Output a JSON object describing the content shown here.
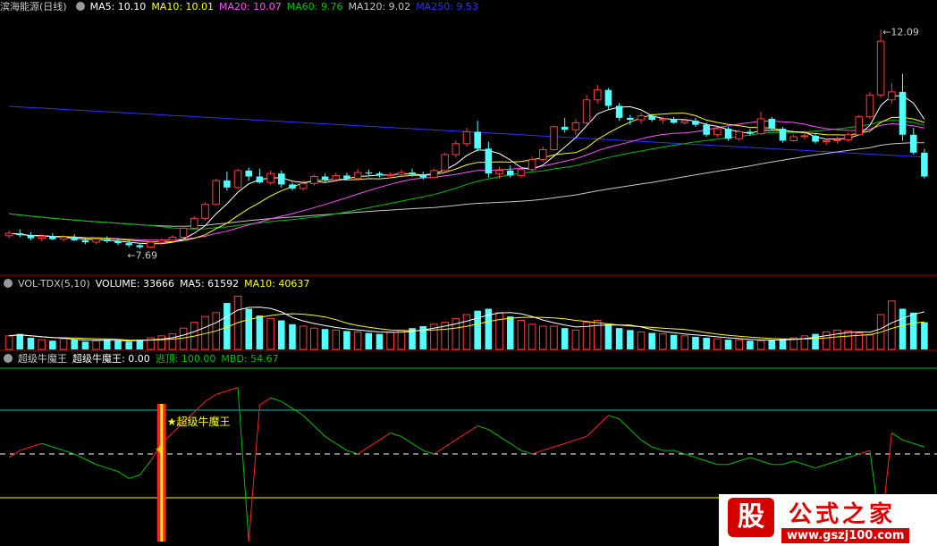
{
  "colors": {
    "up": "#ff3c3c",
    "down": "#54ffff",
    "ma5": "#ffffff",
    "ma10": "#ffff00",
    "ma20": "#ff50ff",
    "ma60": "#00c000",
    "ma120": "#c8c8c8",
    "ma250": "#3030ff",
    "label": "#c8c8c8",
    "panel_border": "#b00000",
    "osc_green": "#00c000",
    "osc_red": "#ff2020",
    "signal_bar": "#ff2020",
    "signal_core": "#ffff00",
    "hline_top": "#00c0c0",
    "hline_bottom": "#ffff00",
    "dash": "#ffffff"
  },
  "price_panel": {
    "stock_name": "滨海能源(日线)",
    "ma_labels": [
      {
        "text": "MA5: 10.10",
        "color": "#ffffff"
      },
      {
        "text": "MA10: 10.01",
        "color": "#ffff00"
      },
      {
        "text": "MA20: 10.07",
        "color": "#ff50ff"
      },
      {
        "text": "MA60: 9.76",
        "color": "#00c000"
      },
      {
        "text": "MA120: 9.02",
        "color": "#c8c8c8"
      },
      {
        "text": "MA250: 9.53",
        "color": "#3030ff"
      }
    ],
    "high_marker": "12.09",
    "low_marker": "7.69"
  },
  "volume_panel": {
    "title": "VOL-TDX(5,10)",
    "labels": [
      {
        "text": "VOLUME: 33666",
        "color": "#ffffff"
      },
      {
        "text": "MA5: 61592",
        "color": "#ffffff"
      },
      {
        "text": "MA10: 40637",
        "color": "#ffff00"
      }
    ]
  },
  "indicator_panel": {
    "title": "超级牛魔王",
    "labels": [
      {
        "text": "超级牛魔王: 0.00",
        "color": "#ffffff"
      },
      {
        "text": "逃顶: 100.00",
        "color": "#00c000"
      },
      {
        "text": "MBD: 54.67",
        "color": "#00c000"
      }
    ],
    "signal_label": "★超级牛魔王"
  },
  "logo": {
    "mark": "股",
    "name": "公式之家",
    "url": "www.gszj100.com"
  },
  "chart_data": [
    {
      "type": "candlestick",
      "ylim": [
        7.3,
        12.4
      ],
      "candles": [
        [
          7.95,
          8.05,
          7.9,
          8.0
        ],
        [
          8.0,
          8.08,
          7.92,
          7.96
        ],
        [
          7.96,
          8.02,
          7.86,
          7.9
        ],
        [
          7.9,
          7.98,
          7.84,
          7.94
        ],
        [
          7.94,
          8.0,
          7.86,
          7.88
        ],
        [
          7.88,
          7.96,
          7.84,
          7.92
        ],
        [
          7.92,
          7.98,
          7.84,
          7.86
        ],
        [
          7.86,
          7.92,
          7.78,
          7.82
        ],
        [
          7.82,
          7.9,
          7.78,
          7.88
        ],
        [
          7.88,
          7.94,
          7.8,
          7.84
        ],
        [
          7.84,
          7.9,
          7.76,
          7.8
        ],
        [
          7.8,
          7.86,
          7.72,
          7.76
        ],
        [
          7.76,
          7.8,
          7.69,
          7.72
        ],
        [
          7.72,
          7.84,
          7.7,
          7.82
        ],
        [
          7.82,
          7.9,
          7.76,
          7.86
        ],
        [
          7.86,
          7.96,
          7.8,
          7.92
        ],
        [
          7.92,
          8.12,
          7.9,
          8.1
        ],
        [
          8.1,
          8.34,
          8.08,
          8.3
        ],
        [
          8.3,
          8.62,
          8.26,
          8.58
        ],
        [
          8.58,
          9.1,
          8.56,
          9.06
        ],
        [
          9.06,
          9.24,
          8.86,
          8.92
        ],
        [
          8.92,
          9.3,
          8.88,
          9.26
        ],
        [
          9.26,
          9.32,
          9.06,
          9.14
        ],
        [
          9.14,
          9.3,
          9.0,
          9.02
        ],
        [
          9.02,
          9.26,
          8.98,
          9.2
        ],
        [
          9.2,
          9.26,
          8.92,
          8.98
        ],
        [
          8.98,
          9.02,
          8.86,
          8.9
        ],
        [
          8.9,
          9.06,
          8.86,
          9.0
        ],
        [
          9.0,
          9.18,
          8.96,
          9.14
        ],
        [
          9.14,
          9.2,
          9.02,
          9.08
        ],
        [
          9.08,
          9.22,
          9.04,
          9.16
        ],
        [
          9.16,
          9.22,
          9.06,
          9.1
        ],
        [
          9.1,
          9.3,
          9.06,
          9.22
        ],
        [
          9.22,
          9.28,
          9.14,
          9.2
        ],
        [
          9.2,
          9.24,
          9.12,
          9.16
        ],
        [
          9.16,
          9.22,
          9.1,
          9.18
        ],
        [
          9.18,
          9.28,
          9.12,
          9.22
        ],
        [
          9.22,
          9.3,
          9.14,
          9.18
        ],
        [
          9.18,
          9.24,
          9.08,
          9.12
        ],
        [
          9.12,
          9.3,
          9.1,
          9.26
        ],
        [
          9.26,
          9.62,
          9.24,
          9.58
        ],
        [
          9.58,
          9.86,
          9.52,
          9.8
        ],
        [
          9.8,
          10.12,
          9.74,
          10.04
        ],
        [
          10.04,
          10.26,
          9.64,
          9.7
        ],
        [
          9.7,
          9.84,
          9.12,
          9.2
        ],
        [
          9.2,
          9.34,
          9.1,
          9.26
        ],
        [
          9.26,
          9.36,
          9.12,
          9.16
        ],
        [
          9.16,
          9.34,
          9.12,
          9.28
        ],
        [
          9.28,
          9.54,
          9.24,
          9.48
        ],
        [
          9.48,
          9.74,
          9.44,
          9.68
        ],
        [
          9.68,
          10.16,
          9.66,
          10.14
        ],
        [
          10.14,
          10.32,
          10.02,
          10.08
        ],
        [
          10.08,
          10.3,
          9.98,
          10.22
        ],
        [
          10.22,
          10.78,
          10.2,
          10.68
        ],
        [
          10.68,
          10.98,
          10.6,
          10.88
        ],
        [
          10.88,
          10.92,
          10.5,
          10.56
        ],
        [
          10.56,
          10.62,
          10.26,
          10.32
        ],
        [
          10.32,
          10.38,
          10.18,
          10.28
        ],
        [
          10.28,
          10.42,
          10.2,
          10.36
        ],
        [
          10.36,
          10.4,
          10.24,
          10.28
        ],
        [
          10.28,
          10.34,
          10.2,
          10.3
        ],
        [
          10.3,
          10.34,
          10.2,
          10.22
        ],
        [
          10.22,
          10.3,
          10.18,
          10.26
        ],
        [
          10.26,
          10.32,
          10.14,
          10.18
        ],
        [
          10.18,
          10.22,
          9.94,
          9.98
        ],
        [
          9.98,
          10.14,
          9.94,
          10.1
        ],
        [
          10.1,
          10.14,
          9.86,
          9.9
        ],
        [
          9.9,
          10.08,
          9.86,
          10.04
        ],
        [
          10.04,
          10.1,
          9.96,
          10.0
        ],
        [
          10.0,
          10.44,
          9.98,
          10.3
        ],
        [
          10.3,
          10.34,
          10.06,
          10.1
        ],
        [
          10.1,
          10.14,
          9.82,
          9.86
        ],
        [
          9.86,
          9.98,
          9.84,
          9.94
        ],
        [
          9.94,
          10.06,
          9.88,
          9.96
        ],
        [
          9.96,
          10.0,
          9.8,
          9.84
        ],
        [
          9.84,
          9.9,
          9.78,
          9.86
        ],
        [
          9.86,
          9.94,
          9.8,
          9.88
        ],
        [
          9.88,
          10.02,
          9.84,
          9.98
        ],
        [
          9.98,
          10.38,
          9.96,
          10.34
        ],
        [
          10.34,
          10.84,
          10.3,
          10.78
        ],
        [
          10.78,
          12.09,
          10.72,
          11.86
        ],
        [
          10.68,
          11.02,
          10.6,
          10.84
        ],
        [
          10.84,
          11.2,
          9.86,
          9.98
        ],
        [
          9.98,
          10.12,
          9.58,
          9.62
        ],
        [
          9.62,
          9.7,
          9.1,
          9.14
        ]
      ]
    },
    {
      "type": "bar",
      "series": [
        {
          "name": "VOLUME",
          "values": [
            14,
            16,
            12,
            10,
            9,
            11,
            10,
            8,
            9,
            10,
            9,
            8,
            10,
            12,
            14,
            16,
            22,
            28,
            34,
            38,
            48,
            55,
            42,
            35,
            32,
            30,
            26,
            24,
            22,
            21,
            20,
            19,
            18,
            17,
            16,
            18,
            20,
            22,
            24,
            26,
            28,
            32,
            36,
            40,
            42,
            38,
            34,
            30,
            26,
            24,
            24,
            22,
            20,
            28,
            30,
            26,
            22,
            20,
            18,
            17,
            16,
            15,
            14,
            13,
            12,
            11,
            10,
            10,
            9,
            9,
            10,
            11,
            12,
            14,
            16,
            18,
            20,
            19,
            17,
            15,
            36,
            50,
            42,
            38,
            28
          ]
        }
      ],
      "ylim": [
        0,
        60
      ]
    },
    {
      "type": "line",
      "series": [
        {
          "name": "MBD",
          "values": [
            48,
            52,
            54,
            56,
            54,
            52,
            50,
            47,
            44,
            42,
            40,
            36,
            38,
            46,
            56,
            62,
            68,
            74,
            80,
            84,
            86,
            88,
            0,
            78,
            82,
            80,
            76,
            72,
            66,
            60,
            56,
            52,
            50,
            54,
            58,
            62,
            60,
            56,
            52,
            50,
            54,
            58,
            62,
            66,
            64,
            60,
            56,
            52,
            50,
            52,
            54,
            56,
            58,
            60,
            66,
            72,
            70,
            64,
            58,
            54,
            52,
            52,
            50,
            48,
            46,
            44,
            44,
            46,
            48,
            46,
            44,
            44,
            46,
            44,
            42,
            44,
            46,
            48,
            50,
            52,
            5,
            62,
            58,
            56,
            54
          ]
        }
      ],
      "ylim": [
        0,
        100
      ]
    }
  ]
}
